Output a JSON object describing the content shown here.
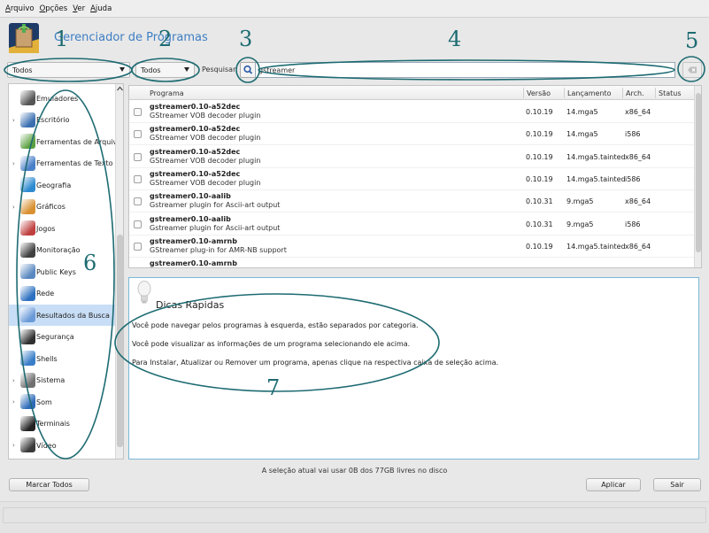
{
  "menu": [
    "Arquivo",
    "Opções",
    "Ver",
    "Ajuda"
  ],
  "header": {
    "title": "Gerenciador de Programas"
  },
  "filters": {
    "type_filter": "Todos",
    "status_filter": "Todos"
  },
  "search": {
    "label": "Pesquisar:",
    "value": "gstreamer"
  },
  "categories": [
    {
      "label": "Emuladores",
      "expandable": false,
      "color": "#555555"
    },
    {
      "label": "Escritório",
      "expandable": true,
      "color": "#3b6fb0"
    },
    {
      "label": "Ferramentas de Arquivo",
      "expandable": false,
      "color": "#5aa040"
    },
    {
      "label": "Ferramentas de Texto",
      "expandable": true,
      "color": "#4a80c8"
    },
    {
      "label": "Geografia",
      "expandable": false,
      "color": "#2d8ad0"
    },
    {
      "label": "Gráficos",
      "expandable": true,
      "color": "#d89030"
    },
    {
      "label": "Jogos",
      "expandable": false,
      "color": "#c04040"
    },
    {
      "label": "Monitoração",
      "expandable": false,
      "color": "#404040"
    },
    {
      "label": "Public Keys",
      "expandable": false,
      "color": "#5a88c0"
    },
    {
      "label": "Rede",
      "expandable": false,
      "color": "#2d70c0"
    },
    {
      "label": "Resultados da Busca",
      "expandable": false,
      "color": "#6a9ad8",
      "selected": true
    },
    {
      "label": "Segurança",
      "expandable": false,
      "color": "#303030"
    },
    {
      "label": "Shells",
      "expandable": false,
      "color": "#3a7ec8"
    },
    {
      "label": "Sistema",
      "expandable": true,
      "color": "#707070"
    },
    {
      "label": "Som",
      "expandable": true,
      "color": "#2d6ab8"
    },
    {
      "label": "Terminais",
      "expandable": false,
      "color": "#222222"
    },
    {
      "label": "Vídeo",
      "expandable": true,
      "color": "#3a3a3a"
    }
  ],
  "table": {
    "columns": {
      "name": "Programa",
      "version": "Versão",
      "release": "Lançamento",
      "arch": "Arch.",
      "status": "Status"
    },
    "rows": [
      {
        "name": "gstreamer0.10-a52dec",
        "desc": "GStreamer VOB decoder plugin",
        "version": "0.10.19",
        "release": "14.mga5",
        "arch": "x86_64"
      },
      {
        "name": "gstreamer0.10-a52dec",
        "desc": "GStreamer VOB decoder plugin",
        "version": "0.10.19",
        "release": "14.mga5",
        "arch": "i586"
      },
      {
        "name": "gstreamer0.10-a52dec",
        "desc": "GStreamer VOB decoder plugin",
        "version": "0.10.19",
        "release": "14.mga5.tainted",
        "arch": "x86_64"
      },
      {
        "name": "gstreamer0.10-a52dec",
        "desc": "GStreamer VOB decoder plugin",
        "version": "0.10.19",
        "release": "14.mga5.tainted",
        "arch": "i586"
      },
      {
        "name": "gstreamer0.10-aalib",
        "desc": "Gstreamer plugin for Ascii-art output",
        "version": "0.10.31",
        "release": "9.mga5",
        "arch": "x86_64"
      },
      {
        "name": "gstreamer0.10-aalib",
        "desc": "Gstreamer plugin for Ascii-art output",
        "version": "0.10.31",
        "release": "9.mga5",
        "arch": "i586"
      },
      {
        "name": "gstreamer0.10-amrnb",
        "desc": "GStreamer plug-in for AMR-NB support",
        "version": "0.10.19",
        "release": "14.mga5.tainted",
        "arch": "x86_64"
      },
      {
        "name": "gstreamer0.10-amrnb",
        "desc": "",
        "version": "",
        "release": "",
        "arch": ""
      }
    ]
  },
  "tips": {
    "title": "Dicas Rápidas",
    "lines": [
      "Você pode navegar pelos programas à esquerda, estão separados por categoria.",
      "Você pode visualizar as informações de um programa selecionando ele acima.",
      "Para Instalar, Atualizar ou Remover um programa, apenas clique na respectiva caixa de seleção acima."
    ]
  },
  "status": "A seleção atual vai usar 0B dos 77GB livres no disco",
  "buttons": {
    "select_all": "Marcar Todos",
    "apply": "Aplicar",
    "quit": "Sair"
  },
  "annotations": [
    "1",
    "2",
    "3",
    "4",
    "5",
    "6",
    "7"
  ],
  "colors": {
    "title": "#3d7ec4",
    "annotation": "#1d6b72",
    "selection": "#c8def6",
    "info_border": "#7ab8d8"
  }
}
